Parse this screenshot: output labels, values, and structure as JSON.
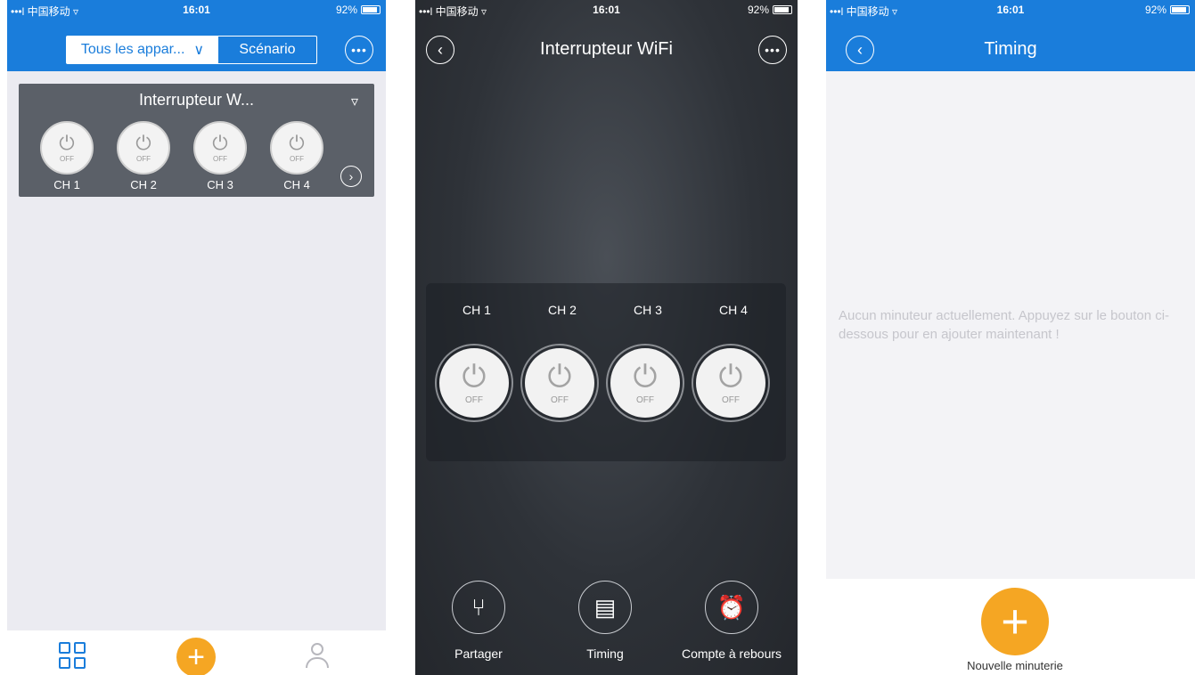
{
  "status": {
    "carrier": "•••l 中国移动 ▿",
    "time": "16:01",
    "battery": "92%"
  },
  "screen1": {
    "segment_selected": "Tous les appar...",
    "segment_other": "Scénario",
    "device_title": "Interrupteur W...",
    "channels": [
      "CH 1",
      "CH 2",
      "CH 3",
      "CH 4"
    ],
    "state_label": "OFF"
  },
  "screen2": {
    "title": "Interrupteur WiFi",
    "channels": [
      "CH 1",
      "CH 2",
      "CH 3",
      "CH 4"
    ],
    "state_label": "OFF",
    "actions": [
      "Partager",
      "Timing",
      "Compte à rebours"
    ]
  },
  "screen3": {
    "title": "Timing",
    "empty_message": "Aucun minuteur actuellement. Appuyez sur le bouton ci-dessous pour en ajouter maintenant !",
    "add_label": "Nouvelle minuterie"
  },
  "colors": {
    "accent": "#1a7ddb",
    "fab": "#f5a623",
    "card": "#5b6068"
  }
}
